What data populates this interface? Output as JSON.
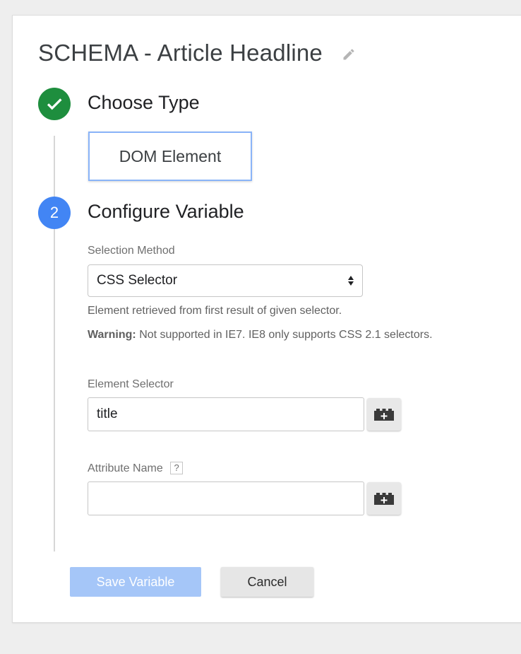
{
  "variable": {
    "title": "SCHEMA - Article Headline"
  },
  "step1": {
    "heading": "Choose Type",
    "selected_type": "DOM Element"
  },
  "step2": {
    "number": "2",
    "heading": "Configure Variable",
    "selection_method": {
      "label": "Selection Method",
      "value": "CSS Selector",
      "help": "Element retrieved from first result of given selector.",
      "warning_label": "Warning:",
      "warning_text": "Not supported in IE7. IE8 only supports CSS 2.1 selectors."
    },
    "element_selector": {
      "label": "Element Selector",
      "value": "title"
    },
    "attribute_name": {
      "label": "Attribute Name",
      "help_badge": "?",
      "value": ""
    }
  },
  "actions": {
    "save_label": "Save Variable",
    "cancel_label": "Cancel"
  },
  "colors": {
    "step_complete": "#1e8e3e",
    "step_active": "#4285f4",
    "save_button_disabled": "#a5c6f8"
  },
  "icons": {
    "edit": "edit-pencil-icon",
    "complete": "checkmark-icon",
    "select": "sort-arrows-icon",
    "variable_picker": "add-variable-brick-icon"
  }
}
